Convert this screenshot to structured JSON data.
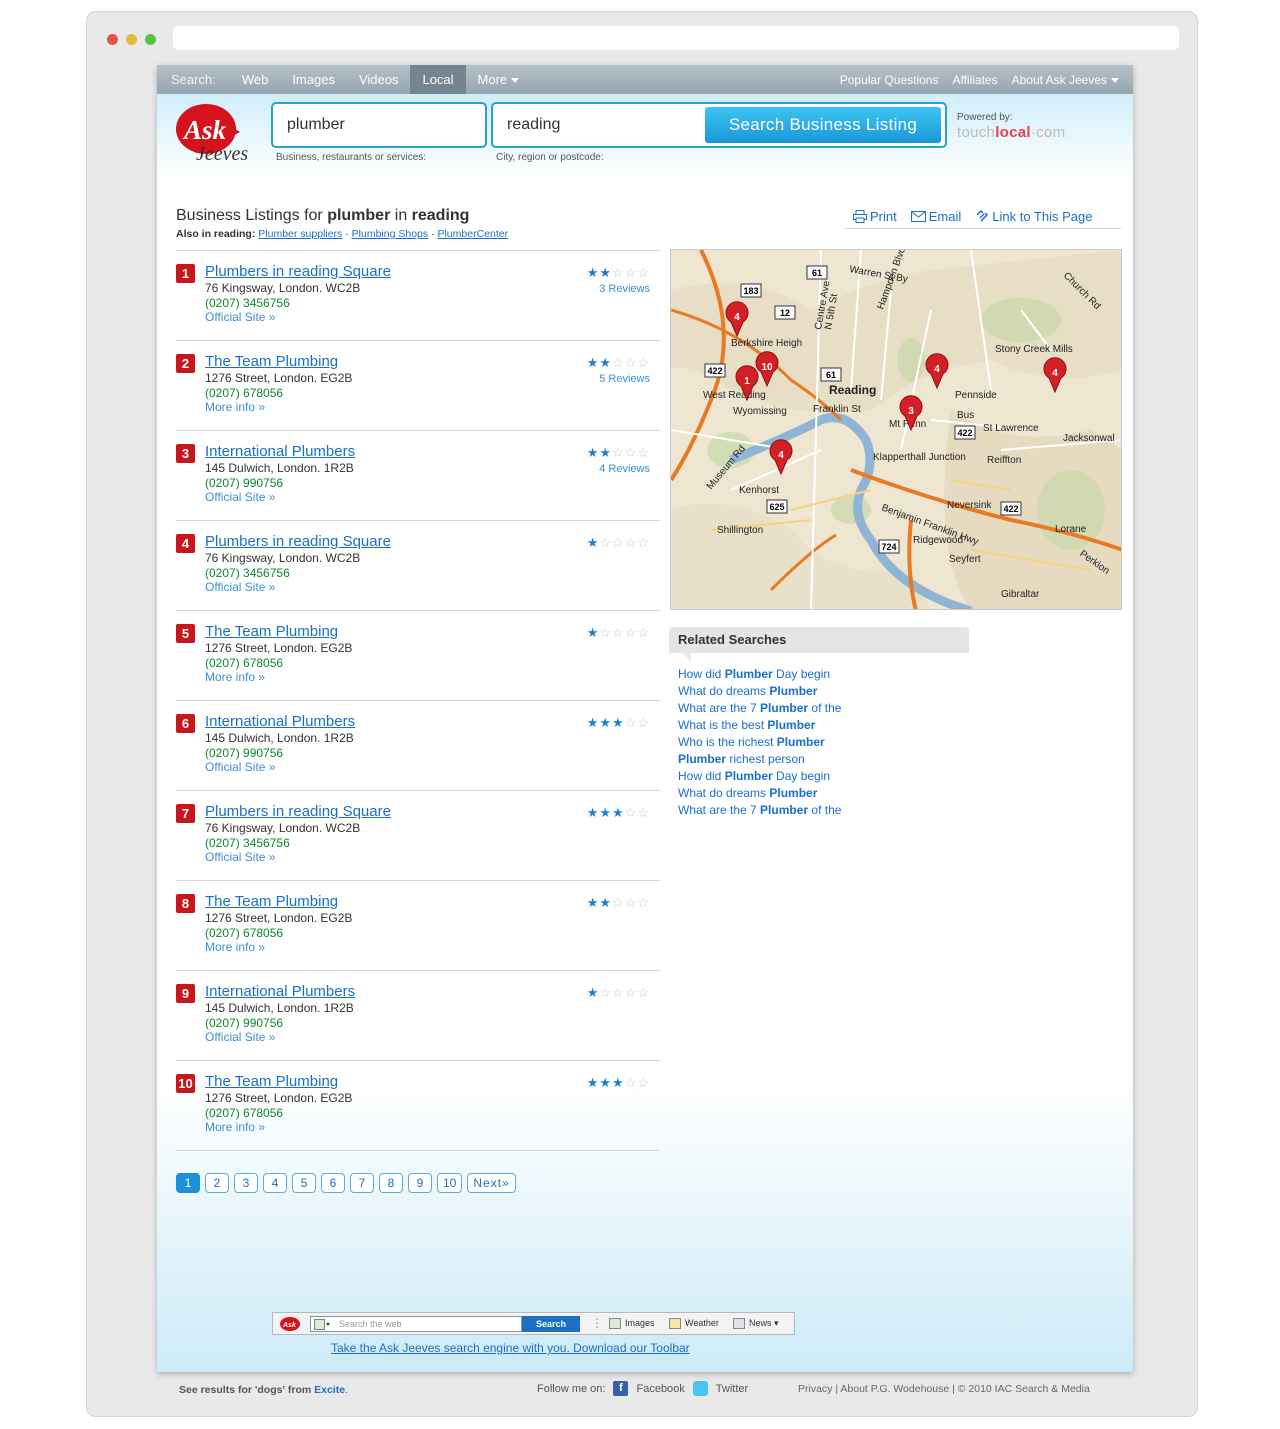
{
  "nav": {
    "search_label": "Search:",
    "items": [
      "Web",
      "Images",
      "Videos",
      "Local",
      "More"
    ],
    "active": "Local",
    "right": [
      "Popular Questions",
      "Affiliates",
      "About Ask Jeeves"
    ]
  },
  "brand": {
    "logo_top": "Ask",
    "logo_bottom": "Jeeves"
  },
  "search": {
    "what_value": "plumber",
    "what_hint": "Business, restaurants or services:",
    "where_value": "reading",
    "where_hint": "City, region or postcode:",
    "button": "Search Business Listing",
    "powered_by": "Powered by:",
    "partner_a": "touch",
    "partner_b": "local",
    "partner_c": "·com"
  },
  "listing": {
    "prefix": "Business Listings for ",
    "query": "plumber",
    "mid": " in ",
    "location": "reading",
    "also_label": "Also in reading:",
    "also": [
      "Plumber suppliers",
      "Plumbing Shops",
      "PlumberCenter"
    ]
  },
  "tools": [
    "Print",
    "Email",
    "Link to This Page"
  ],
  "results": [
    {
      "num": "1",
      "title": "Plumbers in reading Square",
      "address": "76 Kingsway, London. WC2B",
      "phone": "(0207) 3456756",
      "link": "Official Site »",
      "rating": 2,
      "reviews": "3 Reviews"
    },
    {
      "num": "2",
      "title": "The Team Plumbing",
      "address": "1276 Street, London. EG2B",
      "phone": "(0207) 678056",
      "link": "More info »",
      "rating": 2,
      "reviews": "5 Reviews"
    },
    {
      "num": "3",
      "title": "International Plumbers",
      "address": "145 Dulwich, London. 1R2B",
      "phone": "(0207) 990756",
      "link": "Official Site »",
      "rating": 2,
      "reviews": "4 Reviews"
    },
    {
      "num": "4",
      "title": "Plumbers in reading Square",
      "address": "76 Kingsway, London. WC2B",
      "phone": "(0207) 3456756",
      "link": "Official Site »",
      "rating": 1,
      "reviews": ""
    },
    {
      "num": "5",
      "title": "The Team Plumbing",
      "address": "1276 Street, London. EG2B",
      "phone": "(0207) 678056",
      "link": "More info »",
      "rating": 1,
      "reviews": ""
    },
    {
      "num": "6",
      "title": "International Plumbers",
      "address": "145 Dulwich, London. 1R2B",
      "phone": "(0207) 990756",
      "link": "Official Site »",
      "rating": 3,
      "reviews": ""
    },
    {
      "num": "7",
      "title": "Plumbers in reading Square",
      "address": "76 Kingsway, London. WC2B",
      "phone": "(0207) 3456756",
      "link": "Official Site »",
      "rating": 3,
      "reviews": ""
    },
    {
      "num": "8",
      "title": "The Team Plumbing",
      "address": "1276 Street, London. EG2B",
      "phone": "(0207) 678056",
      "link": "More info »",
      "rating": 2,
      "reviews": ""
    },
    {
      "num": "9",
      "title": "International Plumbers",
      "address": "145 Dulwich, London. 1R2B",
      "phone": "(0207) 990756",
      "link": "Official Site »",
      "rating": 1,
      "reviews": ""
    },
    {
      "num": "10",
      "title": "The Team Plumbing",
      "address": "1276 Street, London. EG2B",
      "phone": "(0207) 678056",
      "link": "More info »",
      "rating": 3,
      "reviews": ""
    }
  ],
  "pager": {
    "pages": [
      "1",
      "2",
      "3",
      "4",
      "5",
      "6",
      "7",
      "8",
      "9",
      "10"
    ],
    "active": "1",
    "next": "Next»"
  },
  "map": {
    "labels": [
      "Warren St By",
      "Berkshire Heigh",
      "West Reading",
      "Wyomissing",
      "Reading",
      "Franklin St",
      "Mt Penn",
      "Pennside",
      "Stony Creek Mills",
      "St Lawrence",
      "Reiffton",
      "Jacksonwal",
      "Klapperthall Junction",
      "Kenhorst",
      "Shillington",
      "Neversink",
      "Ridgewood",
      "Seyfert",
      "Lorane",
      "Perkion",
      "Gibraltar",
      "Church Rd",
      "Hampden Blvd",
      "Centre Ave",
      "N 5th St",
      "Benjamin Franklin Hwy",
      "Museum Rd",
      "Bus"
    ],
    "shields": [
      "183",
      "61",
      "12",
      "422",
      "61",
      "422",
      "625",
      "724",
      "422"
    ],
    "pins": [
      "4",
      "1",
      "10",
      "4",
      "3",
      "4",
      "4"
    ]
  },
  "related": {
    "heading": "Related Searches",
    "items": [
      {
        "pre": "How did ",
        "bold": "Plumber",
        "post": " Day begin"
      },
      {
        "pre": "What do dreams ",
        "bold": "Plumber",
        "post": ""
      },
      {
        "pre": "What are the 7 ",
        "bold": "Plumber",
        "post": " of the"
      },
      {
        "pre": "What is the best ",
        "bold": "Plumber",
        "post": ""
      },
      {
        "pre": "Who is the richest ",
        "bold": "Plumber",
        "post": ""
      },
      {
        "pre": "",
        "bold": "Plumber",
        "post": " richest person"
      },
      {
        "pre": "How did ",
        "bold": "Plumber",
        "post": " Day begin"
      },
      {
        "pre": "What do dreams ",
        "bold": "Plumber",
        "post": ""
      },
      {
        "pre": "What are the 7 ",
        "bold": "Plumber",
        "post": " of the"
      }
    ]
  },
  "toolbar": {
    "placeholder": "Search the web",
    "button": "Search",
    "images": "Images",
    "weather": "Weather",
    "news": "News",
    "promo": "Take the Ask Jeeves search engine with you. Download our Toolbar"
  },
  "footer": {
    "see_results": "See results for 'dogs' from ",
    "excite": "Excite",
    "period": ".",
    "follow": "Follow me on:",
    "facebook": "Facebook",
    "twitter": "Twitter",
    "legal": "Privacy  |  About P.G. Wodehouse  |  © 2010 IAC Search & Media"
  },
  "colors": {
    "accent": "#1a98d8",
    "link": "#1a6fc9",
    "badge": "#c8171c",
    "phone": "#0a8a2a",
    "pin": "#d41f26"
  }
}
